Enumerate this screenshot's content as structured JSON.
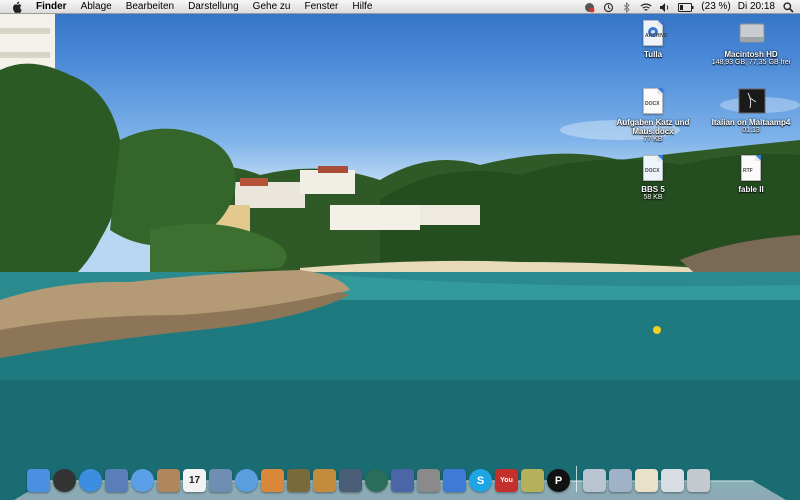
{
  "menubar": {
    "apple_icon": "apple-logo-icon",
    "items": [
      "Finder",
      "Ablage",
      "Bearbeiten",
      "Darstellung",
      "Gehe zu",
      "Fenster",
      "Hilfe"
    ],
    "battery_text": "(23 %)",
    "clock": "Di 20:18",
    "status_icons": [
      "sync-alert-icon",
      "time-machine-icon",
      "bluetooth-icon",
      "wifi-icon",
      "volume-icon",
      "battery-icon",
      "spotlight-search-icon"
    ]
  },
  "desktop": {
    "icons": [
      {
        "label": "Tulla",
        "sub": "",
        "tag": "ARCHIVE"
      },
      {
        "label": "Macintosh HD",
        "sub": "148,93 GB, 77,35 GB frei",
        "tag": ""
      },
      {
        "label": "Aufgaben Katz und",
        "label2": "Maus.docx",
        "sub": "77 KB",
        "tag": "DOCX"
      },
      {
        "label": "Italian on Maltaamp4",
        "sub": "01:13",
        "tag": ""
      },
      {
        "label": "BBS 5",
        "sub": "58 KB",
        "tag": "DOCX"
      },
      {
        "label": "fable II",
        "sub": "",
        "tag": "RTF"
      }
    ]
  },
  "dock": {
    "items": [
      {
        "name": "finder",
        "color": "#4a90e2"
      },
      {
        "name": "dashboard",
        "color": "#333333"
      },
      {
        "name": "safari",
        "color": "#3d8ee0"
      },
      {
        "name": "mail",
        "color": "#5a7fb8"
      },
      {
        "name": "ichat",
        "color": "#5aa0e8"
      },
      {
        "name": "address-book",
        "color": "#b0875a"
      },
      {
        "name": "ical",
        "color": "#f2f2f2",
        "text": "17"
      },
      {
        "name": "preview",
        "color": "#6e8fb3"
      },
      {
        "name": "itunes",
        "color": "#5b9ee0"
      },
      {
        "name": "iphoto",
        "color": "#d9883a"
      },
      {
        "name": "imovie",
        "color": "#7a6a3a"
      },
      {
        "name": "garageband",
        "color": "#c28b3d"
      },
      {
        "name": "spaces",
        "color": "#4a5e78"
      },
      {
        "name": "time-machine",
        "color": "#2a6e5a"
      },
      {
        "name": "automator",
        "color": "#4a66a6"
      },
      {
        "name": "system-preferences",
        "color": "#8a8a8a"
      },
      {
        "name": "word",
        "color": "#3f7ad6"
      },
      {
        "name": "skype",
        "color": "#1ea5e6",
        "text": "S"
      },
      {
        "name": "youtube",
        "color": "#c4302b",
        "text": "You"
      },
      {
        "name": "star-app",
        "color": "#b5b15a"
      },
      {
        "name": "pages",
        "color": "#111111",
        "text": "P"
      },
      {
        "name": "applications-folder",
        "color": "#b8c4d0"
      },
      {
        "name": "pictures-folder",
        "color": "#9fb2c8"
      },
      {
        "name": "documents-stack",
        "color": "#e8e2c8"
      },
      {
        "name": "downloads-stack",
        "color": "#d8dde4"
      },
      {
        "name": "trash",
        "color": "#c4c9cf"
      }
    ]
  }
}
